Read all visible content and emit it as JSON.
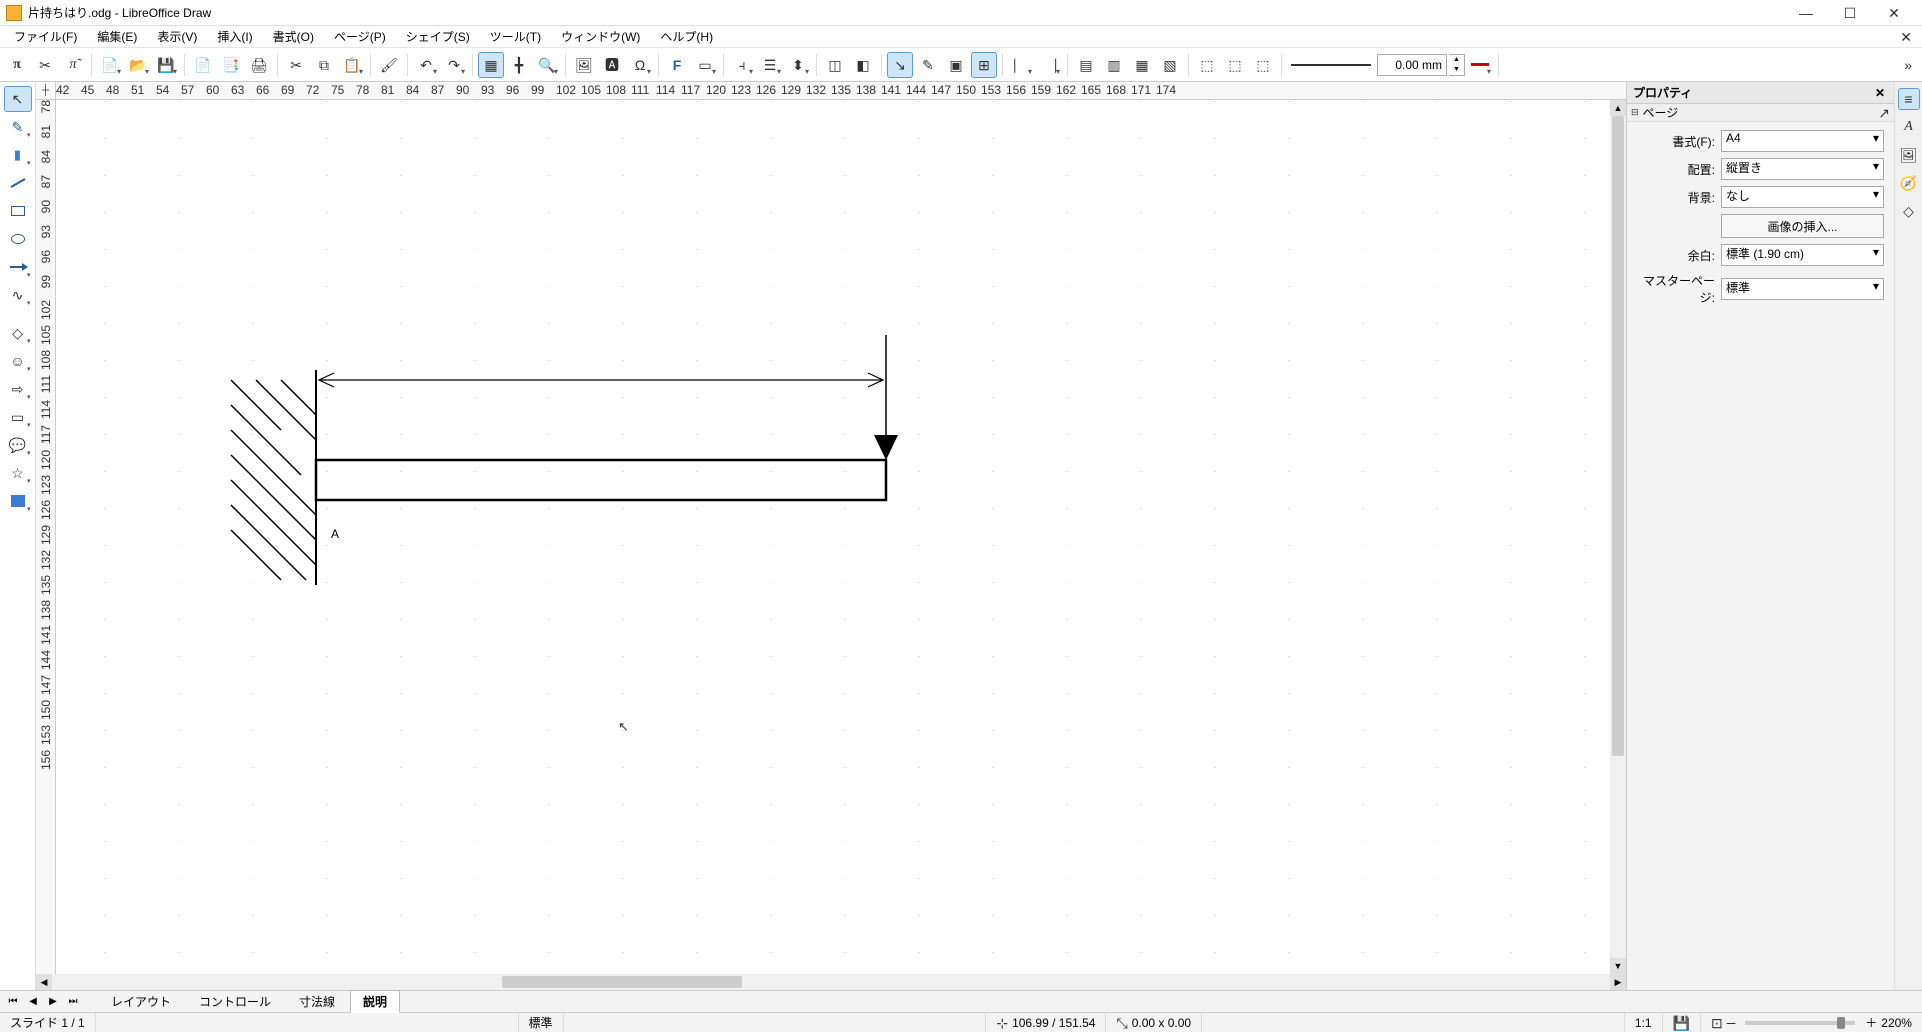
{
  "title": "片持ちはり.odg - LibreOffice Draw",
  "menubar": [
    "ファイル(F)",
    "編集(E)",
    "表示(V)",
    "挿入(I)",
    "書式(O)",
    "ページ(P)",
    "シェイプ(S)",
    "ツール(T)",
    "ウィンドウ(W)",
    "ヘルプ(H)"
  ],
  "toolbar": {
    "line_width_value": "0.00 mm"
  },
  "hruler_ticks": [
    "42",
    "45",
    "48",
    "51",
    "54",
    "57",
    "60",
    "63",
    "66",
    "69",
    "72",
    "75",
    "78",
    "81",
    "84",
    "87",
    "90",
    "93",
    "96",
    "99",
    "102",
    "105",
    "108",
    "111",
    "114",
    "117",
    "120",
    "123",
    "126",
    "129",
    "132",
    "135",
    "138",
    "141",
    "144",
    "147",
    "150",
    "153",
    "156",
    "159",
    "162",
    "165",
    "168",
    "171",
    "174"
  ],
  "vruler_ticks": [
    "78",
    "81",
    "84",
    "87",
    "90",
    "93",
    "96",
    "99",
    "102",
    "105",
    "108",
    "111",
    "114",
    "117",
    "120",
    "123",
    "126",
    "129",
    "132",
    "135",
    "138",
    "141",
    "144",
    "147",
    "150",
    "153",
    "156"
  ],
  "drawing": {
    "label_A": "A"
  },
  "sidepanel": {
    "title": "プロパティ",
    "section": "ページ",
    "format_label": "書式(F):",
    "format_value": "A4",
    "orient_label": "配置:",
    "orient_value": "縦置き",
    "bg_label": "背景:",
    "bg_value": "なし",
    "insert_image_btn": "画像の挿入...",
    "margin_label": "余白:",
    "margin_value": "標準 (1.90 cm)",
    "master_label": "マスターページ:",
    "master_value": "標準"
  },
  "pagetabs": {
    "tabs": [
      "レイアウト",
      "コントロール",
      "寸法線",
      "説明"
    ],
    "active_index": 3
  },
  "status": {
    "slide": "スライド 1 / 1",
    "style": "標準",
    "pos": "106.99 / 151.54",
    "size": "0.00 x 0.00",
    "scale": "1:1",
    "zoom": "220%"
  }
}
